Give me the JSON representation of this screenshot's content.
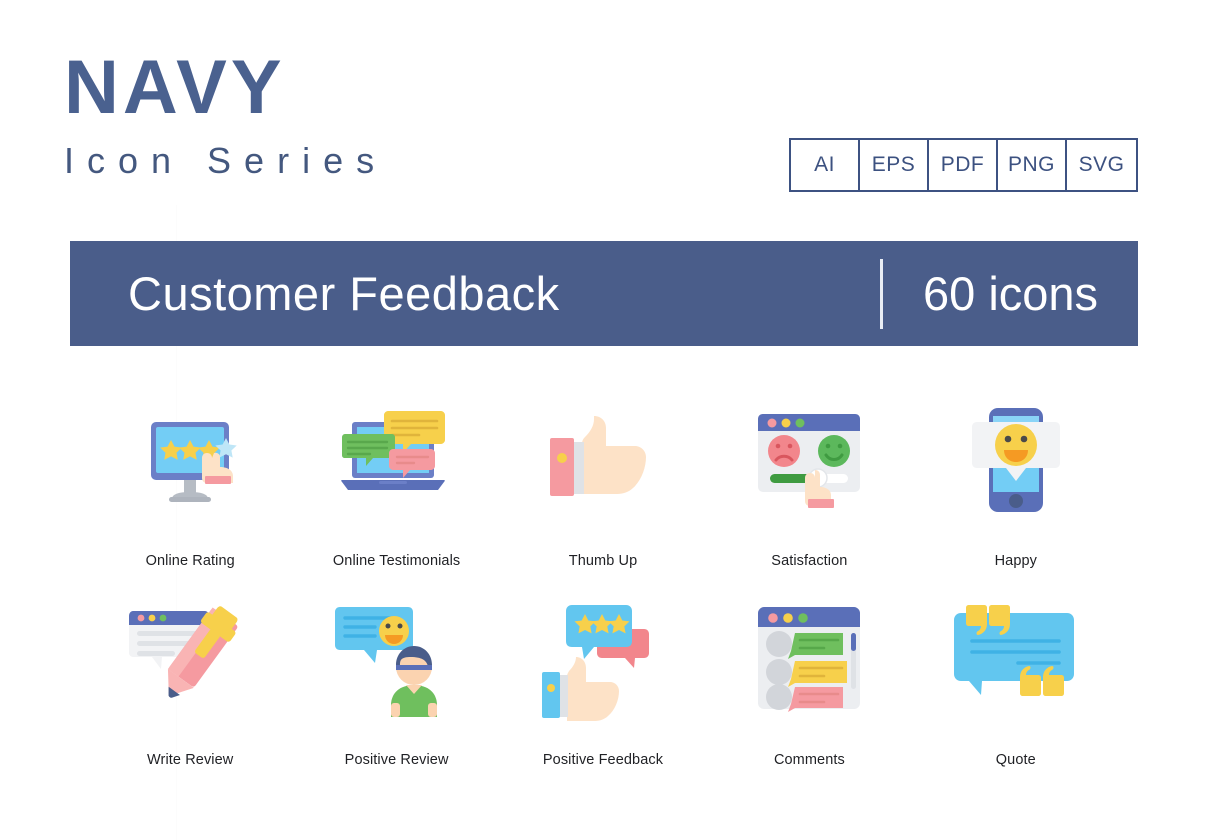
{
  "brand": {
    "title": "NAVY",
    "subtitle": "Icon Series",
    "title_color": "#4a618f",
    "subtitle_color": "#44587f"
  },
  "formats": [
    {
      "label": "AI"
    },
    {
      "label": "EPS"
    },
    {
      "label": "PDF"
    },
    {
      "label": "PNG"
    },
    {
      "label": "SVG"
    }
  ],
  "banner": {
    "title": "Customer Feedback",
    "count": "60 icons",
    "background": "#4a5d8a",
    "text_color": "#ffffff"
  },
  "palette": {
    "navy": "#4a5d8a",
    "periwinkle": "#6b7fc7",
    "sky": "#73cdf5",
    "sky_light": "#8ad4f7",
    "yellow": "#f7d04b",
    "yellow_deep": "#f3c53f",
    "skin": "#fbd3b0",
    "skin_light": "#fde2c7",
    "pink": "#f59aa0",
    "pink_light": "#f9b4b4",
    "green": "#6fbf5e",
    "green_bright": "#5cb85c",
    "grey": "#d8dade",
    "grey_light": "#eceef1",
    "white": "#ffffff"
  },
  "icons": [
    {
      "id": "online-rating",
      "label": "Online Rating"
    },
    {
      "id": "online-testimonials",
      "label": "Online Testimonials"
    },
    {
      "id": "thumb-up",
      "label": "Thumb Up"
    },
    {
      "id": "satisfaction",
      "label": "Satisfaction"
    },
    {
      "id": "happy",
      "label": "Happy"
    },
    {
      "id": "write-review",
      "label": "Write Review"
    },
    {
      "id": "positive-review",
      "label": "Positive Review"
    },
    {
      "id": "positive-feedback",
      "label": "Positive Feedback"
    },
    {
      "id": "comments",
      "label": "Comments"
    },
    {
      "id": "quote",
      "label": "Quote"
    }
  ]
}
